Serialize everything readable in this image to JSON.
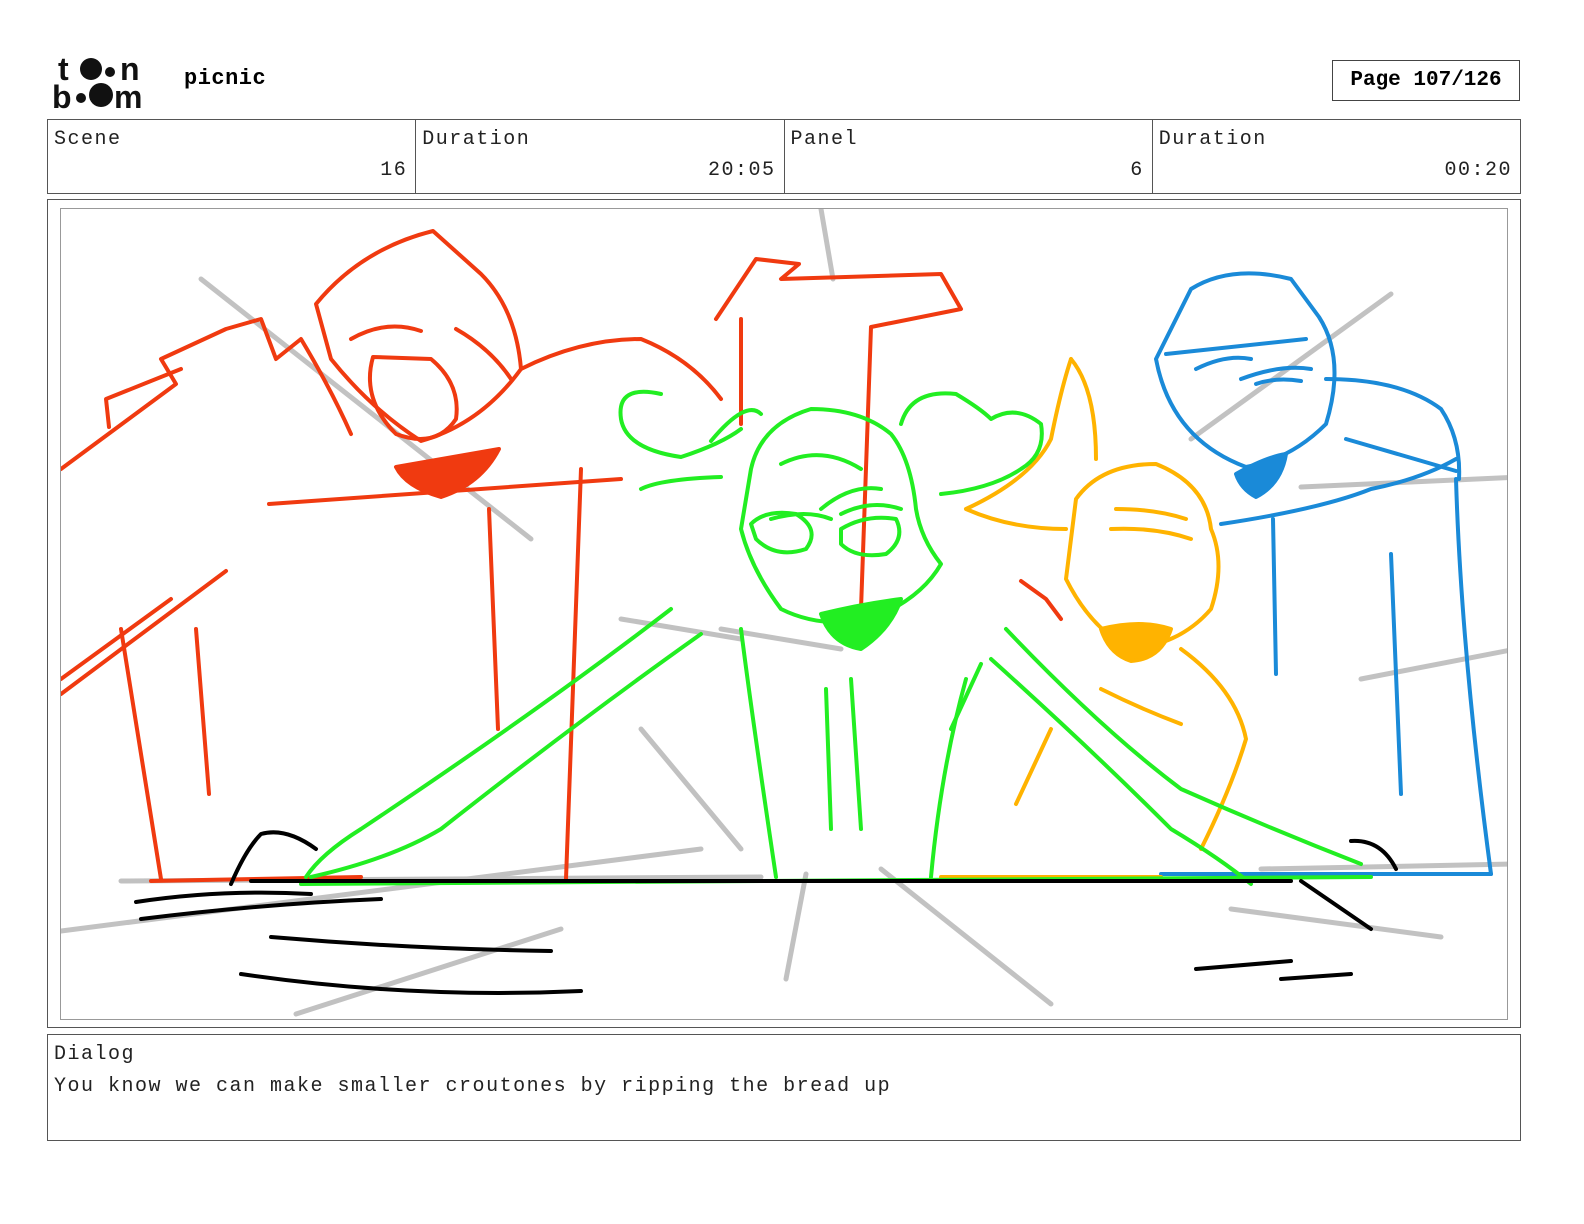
{
  "header": {
    "logo_text": "toon boom",
    "project_title": "picnic",
    "page_label": "Page 107/126"
  },
  "info": {
    "scene_label": "Scene",
    "scene_value": "16",
    "scene_duration_label": "Duration",
    "scene_duration_value": "20:05",
    "panel_label": "Panel",
    "panel_value": "6",
    "panel_duration_label": "Duration",
    "panel_duration_value": "00:20"
  },
  "sketch": {
    "colors": {
      "red_character": "#f03a10",
      "green_character": "#22ee22",
      "yellow_character": "#ffb300",
      "blue_character": "#1a8ad8",
      "table_lines": "#000000",
      "background_rays": "#bbbbbb"
    }
  },
  "dialog": {
    "label": "Dialog",
    "text": "You know we can make smaller croutones by ripping the bread up"
  }
}
